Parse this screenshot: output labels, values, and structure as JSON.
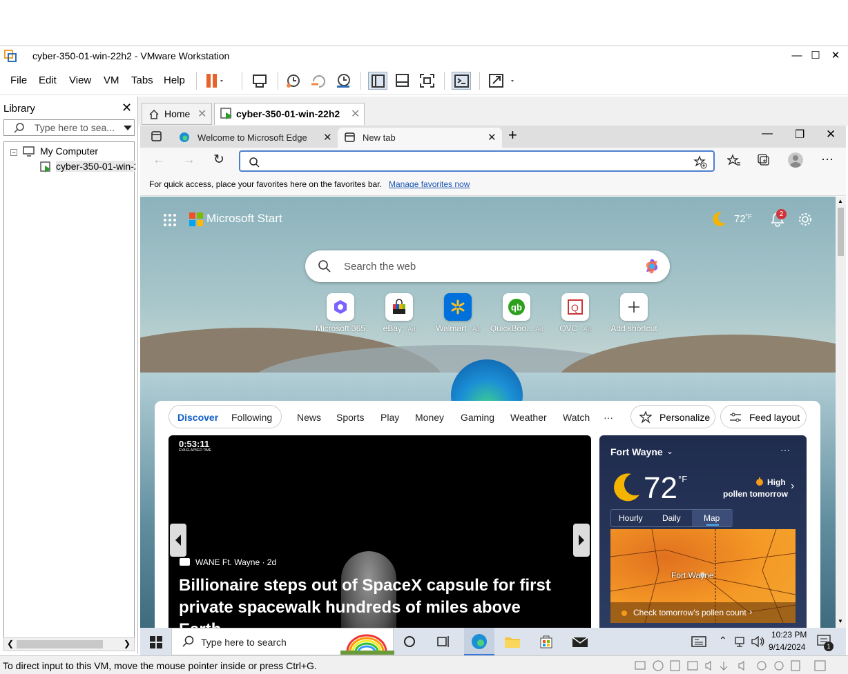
{
  "window": {
    "title": "cyber-350-01-win-22h2 - VMware Workstation",
    "minimize": "—",
    "maximize": "☐",
    "close": "✕"
  },
  "menu": [
    "File",
    "Edit",
    "View",
    "VM",
    "Tabs",
    "Help"
  ],
  "library": {
    "title": "Library",
    "search_placeholder": "Type here to sea...",
    "tree": {
      "root": "My Computer",
      "child": "cyber-350-01-win-22h2"
    }
  },
  "vm_tabs": {
    "home": "Home",
    "vm": "cyber-350-01-win-22h2"
  },
  "edge": {
    "tabs": [
      "Welcome to Microsoft Edge",
      "New tab"
    ],
    "address_value": "",
    "favbar_message": "For quick access, place your favorites here on the favorites bar.",
    "favbar_link": "Manage favorites now"
  },
  "start": {
    "brand": "Microsoft Start",
    "temp": "72",
    "temp_unit": "°F",
    "notif_count": "2",
    "search_placeholder": "Search the web",
    "shortcuts": [
      {
        "label": "Microsoft 365",
        "ad": ""
      },
      {
        "label": "eBay",
        "ad": "· Ad"
      },
      {
        "label": "Walmart",
        "ad": "· Ad"
      },
      {
        "label": "QuickBoo...",
        "ad": "Ad"
      },
      {
        "label": "QVC",
        "ad": "· Ad"
      },
      {
        "label": "Add shortcut",
        "ad": ""
      }
    ]
  },
  "feed": {
    "tabs": [
      "Discover",
      "Following"
    ],
    "nav": [
      "News",
      "Sports",
      "Play",
      "Money",
      "Gaming",
      "Weather",
      "Watch",
      "···"
    ],
    "personalize": "Personalize",
    "feed_layout": "Feed layout",
    "hero": {
      "timer": "0:53:11",
      "timer_sub": "EVA ELAPSED TIME",
      "source": "WANE Ft. Wayne · 2d",
      "headline": "Billionaire steps out of SpaceX capsule for first private spacewalk hundreds of miles above Earth"
    },
    "weather": {
      "location": "Fort Wayne",
      "temp": "72",
      "unit": "°F",
      "pollen_level": "High",
      "pollen_when": "pollen tomorrow",
      "tabs": [
        "Hourly",
        "Daily",
        "Map"
      ],
      "map_city": "Fort Wayne",
      "footer": "Check tomorrow's pollen count"
    }
  },
  "taskbar": {
    "search_placeholder": "Type here to search",
    "time": "10:23 PM",
    "date": "9/14/2024",
    "notif": "1"
  },
  "status": "To direct input to this VM, move the mouse pointer inside or press Ctrl+G."
}
